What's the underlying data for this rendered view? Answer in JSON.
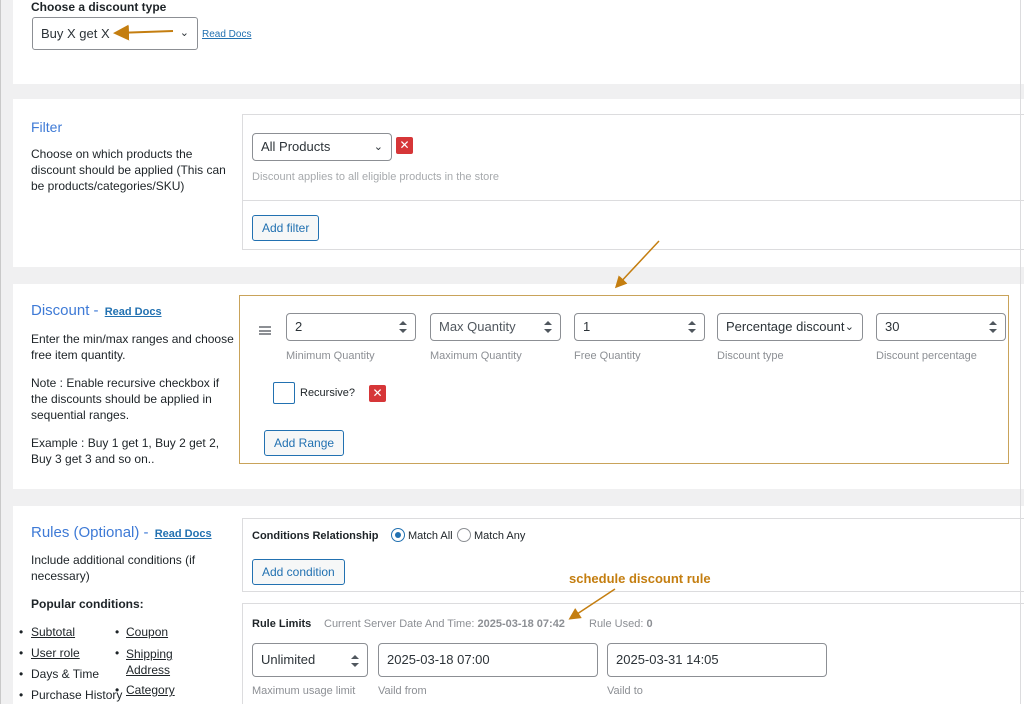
{
  "discount_type": {
    "label": "Choose a discount type",
    "selected": "Buy X get X",
    "read_docs": "Read Docs"
  },
  "filter": {
    "title": "Filter",
    "description": "Choose on which products the discount should be applied (This can be products/categories/SKU)",
    "selected": "All Products",
    "hint": "Discount applies to all eligible products in the store",
    "add_filter": "Add filter"
  },
  "discount": {
    "title": "Discount -",
    "read_docs": "Read Docs",
    "desc1": "Enter the min/max ranges and choose free item quantity.",
    "desc2": "Note : Enable recursive checkbox if the discounts should be applied in sequential ranges.",
    "desc3": "Example : Buy 1 get 1, Buy 2 get 2, Buy 3 get 3 and so on..",
    "min_qty": {
      "value": "2",
      "label": "Minimum Quantity"
    },
    "max_qty": {
      "placeholder": "Max Quantity",
      "label": "Maximum Quantity"
    },
    "free_qty": {
      "value": "1",
      "label": "Free Quantity"
    },
    "disc_type": {
      "value": "Percentage discount",
      "label": "Discount type"
    },
    "disc_pct": {
      "value": "30",
      "label": "Discount percentage"
    },
    "recursive": "Recursive?",
    "add_range": "Add Range"
  },
  "rules": {
    "title": "Rules (Optional) -",
    "read_docs": "Read Docs",
    "description": "Include additional conditions (if necessary)",
    "popular": "Popular conditions:",
    "conditions_col1": [
      "Subtotal",
      "User role",
      "Days & Time",
      "Purchase History"
    ],
    "conditions_col2": [
      "Coupon",
      "Shipping Address",
      "Category"
    ],
    "relationship_label": "Conditions Relationship",
    "match_all": "Match All",
    "match_any": "Match Any",
    "add_condition": "Add condition",
    "limits_label": "Rule Limits",
    "server_time_label": "Current Server Date And Time:",
    "server_time_value": "2025-03-18 07:42",
    "rule_used_label": "Rule Used:",
    "rule_used_value": "0",
    "usage_limit": {
      "value": "Unlimited",
      "label": "Maximum usage limit"
    },
    "valid_from": {
      "value": "2025-03-18 07:00",
      "label": "Vaild from"
    },
    "valid_to": {
      "value": "2025-03-31 14:05",
      "label": "Vaild to"
    }
  },
  "annotation": "schedule discount rule",
  "colors": {
    "accent": "#2271b1",
    "heading": "#3e7ad6",
    "annotation": "#c47e10",
    "danger": "#d63638"
  }
}
